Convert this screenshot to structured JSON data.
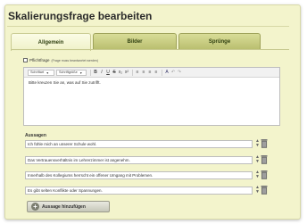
{
  "window": {
    "title": "Skalierungsfrage bearbeiten"
  },
  "tabs": [
    {
      "label": "Allgemein",
      "active": true
    },
    {
      "label": "Bilder",
      "active": false
    },
    {
      "label": "Sprünge",
      "active": false
    }
  ],
  "mandatory": {
    "label": "Pflichtfrage",
    "hint": "(Frage muss beantwortet werden)",
    "checked": false
  },
  "editor": {
    "font_family": "Schriftart",
    "font_size": "Schriftgröße",
    "toolbar_icons": [
      "bold-icon",
      "italic-icon",
      "underline-icon",
      "strikethrough-icon",
      "subscript-icon",
      "superscript-icon",
      "align-left-icon",
      "align-center-icon",
      "align-right-icon",
      "align-justify-icon",
      "text-color-icon",
      "undo-icon",
      "redo-icon"
    ],
    "content": "Bitte kreuzen Sie an, was auf Sie zutrifft."
  },
  "answers": {
    "label": "Aussagen",
    "items": [
      "Ich fühle mich an unserer Schule wohl.",
      "Das Vertrauensverhältnis im Lehrerzimmer ist angenehm.",
      "Innerhalb des Kollegiums herrscht ein offener Umgang mit Problemen.",
      "Es gibt selten Konflikte oder Spannungen."
    ]
  },
  "add_button": {
    "label": "Aussage hinzufügen"
  },
  "colors": {
    "panel": "#f3f4cc",
    "tab_inactive": "#c9cd82",
    "tab_active": "#f6f7dc"
  }
}
